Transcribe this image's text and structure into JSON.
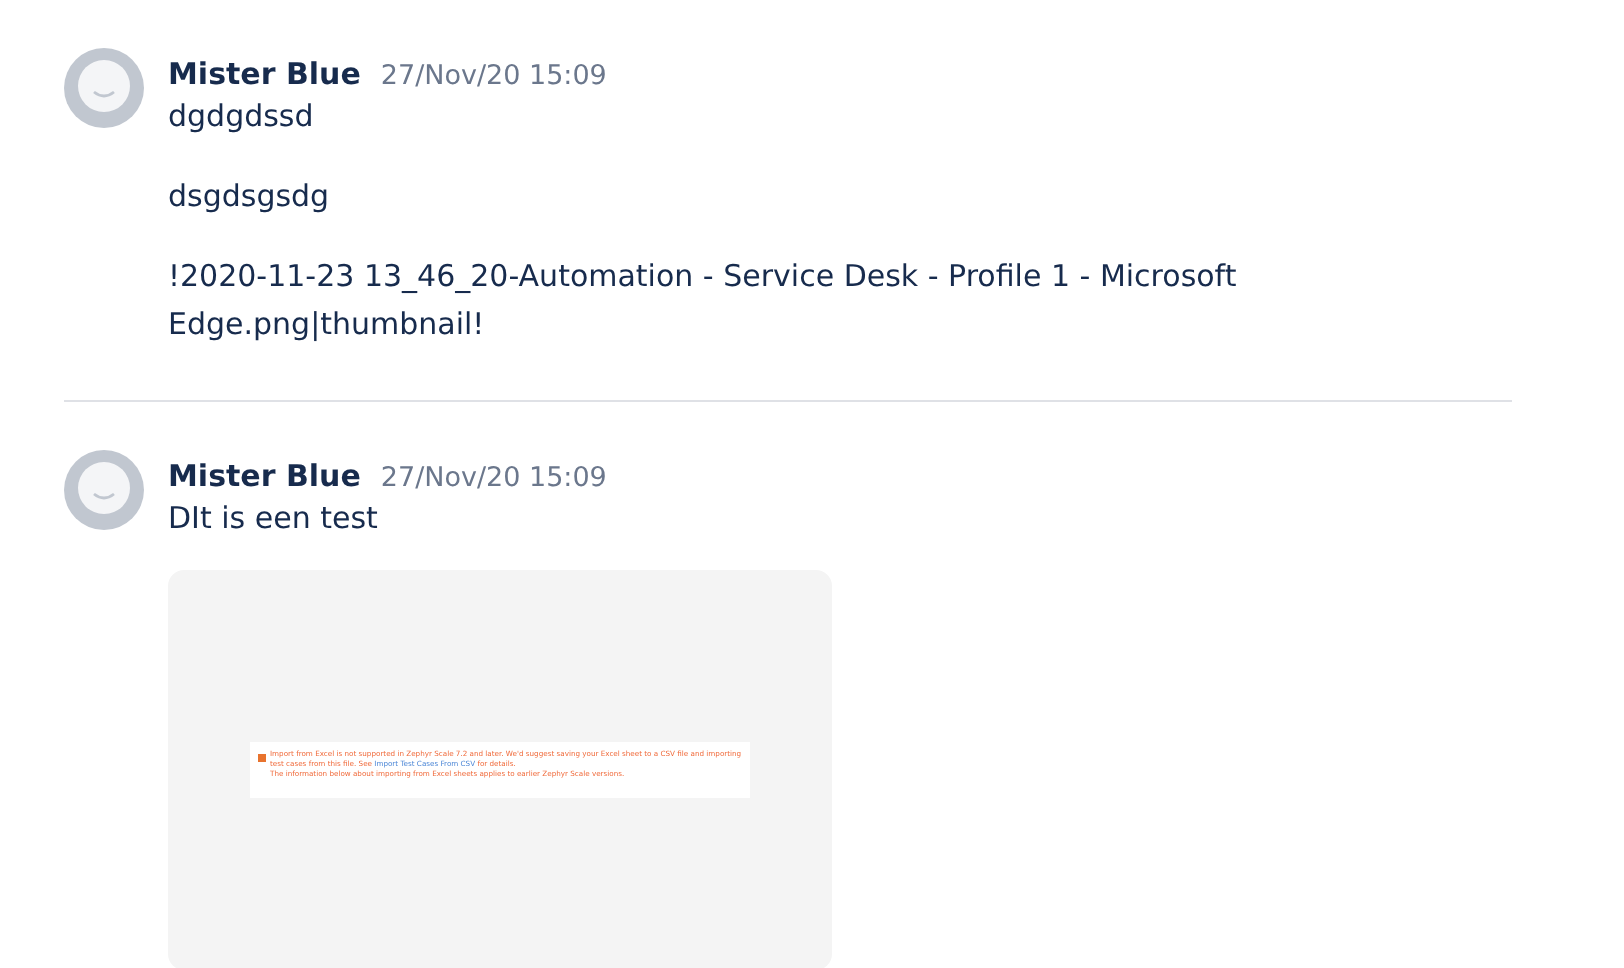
{
  "comments": [
    {
      "author": "Mister Blue",
      "time": "27/Nov/20 15:09",
      "paragraphs": [
        "dgdgdssd",
        "dsgdsgsdg",
        "!2020-11-23 13_46_20-Automation - Service Desk - Profile 1 - Microsoft Edge.png|thumbnail!"
      ]
    },
    {
      "author": "Mister Blue",
      "time": "27/Nov/20 15:09",
      "paragraphs": [
        "DIt is een test"
      ],
      "attachment": {
        "kind": "screenshot",
        "notice": {
          "lines": [
            "Import from Excel is not supported in Zephyr Scale 7.2 and later. We'd suggest saving your Excel sheet to a CSV file and importing test cases from this file. See ",
            "The information below about importing from Excel sheets applies to earlier Zephyr Scale versions."
          ],
          "link": "Import Test Cases From CSV",
          "after_link": " for details."
        }
      }
    }
  ]
}
